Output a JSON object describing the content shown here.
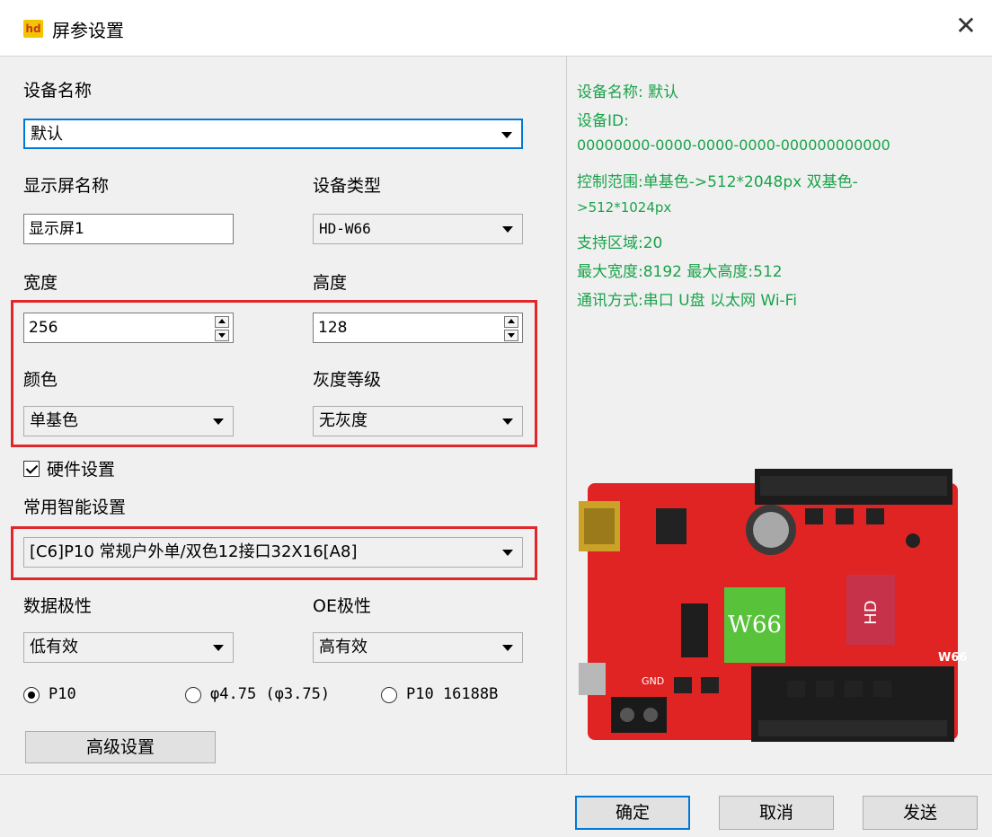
{
  "window": {
    "title": "屏参设置",
    "icon_text": "hd",
    "close_glyph": "✕"
  },
  "device_name": {
    "label": "设备名称",
    "value": "默认"
  },
  "screen_name": {
    "label": "显示屏名称",
    "value": "显示屏1"
  },
  "device_type": {
    "label": "设备类型",
    "value": "HD-W66"
  },
  "width": {
    "label": "宽度",
    "value": "256"
  },
  "height": {
    "label": "高度",
    "value": "128"
  },
  "color": {
    "label": "颜色",
    "value": "单基色"
  },
  "gray_level": {
    "label": "灰度等级",
    "value": "无灰度"
  },
  "hardware": {
    "label": "硬件设置",
    "checked": true
  },
  "smart_setting": {
    "label": "常用智能设置",
    "value": "[C6]P10  常规户外单/双色12接口32X16[A8]"
  },
  "data_polarity": {
    "label": "数据极性",
    "value": "低有效"
  },
  "oe_polarity": {
    "label": "OE极性",
    "value": "高有效"
  },
  "module_radios": [
    {
      "label": "P10",
      "selected": true
    },
    {
      "label": "φ4.75 (φ3.75)",
      "selected": false
    },
    {
      "label": "P10 16188B",
      "selected": false
    }
  ],
  "advanced_button": "高级设置",
  "info": {
    "line1": "设备名称: 默认",
    "line2": "设备ID:",
    "line3": "00000000-0000-0000-0000-000000000000",
    "line4": "控制范围:单基色->512*2048px  双基色-",
    "line5": ">512*1024px",
    "line6": "支持区域:20",
    "line7": "最大宽度:8192 最大高度:512",
    "line8": "通讯方式:串口  U盘  以太网  Wi-Fi"
  },
  "board_image": {
    "chip_label": "W66",
    "brand": "HD",
    "edge_label": "W66",
    "gnd": "GND"
  },
  "footer": {
    "ok": "确定",
    "cancel": "取消",
    "send": "发送"
  },
  "colors": {
    "accent": "#0078d7",
    "highlight_box": "#e3262c",
    "info_text": "#1aa34a",
    "board": "#e02424"
  }
}
